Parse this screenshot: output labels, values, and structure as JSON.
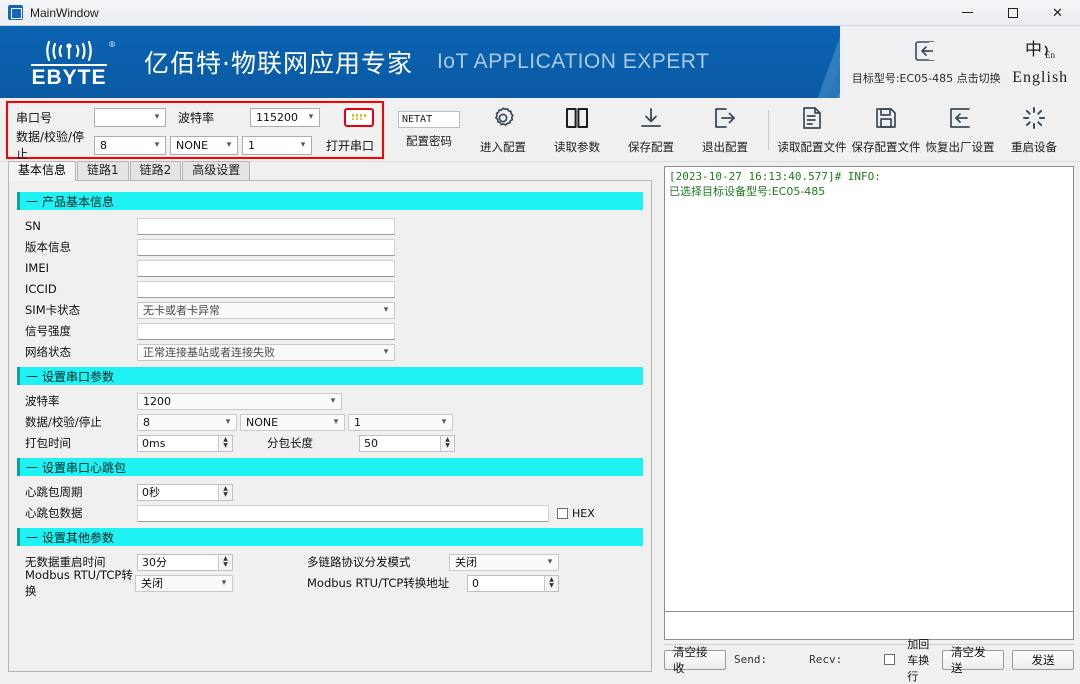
{
  "window": {
    "title": "MainWindow",
    "minimize": "—",
    "maximize": "□",
    "close": "✕"
  },
  "banner": {
    "logo_text": "EBYTE",
    "logo_reg": "®",
    "slogan_cn": "亿佰特·物联网应用专家",
    "slogan_en": "IoT APPLICATION EXPERT",
    "target_model": "目标型号:EC05-485 点击切换",
    "language": "English",
    "brand_blue": "#0a5fab",
    "stripe_colors": [
      "#2f7cbf",
      "#5393cb",
      "#7aadd8",
      "#a3c6e3",
      "#c6dbed",
      "#e2ecf4"
    ]
  },
  "serial": {
    "port_label": "串口号",
    "port_value": "",
    "baud_label": "波特率",
    "baud_value": "115200",
    "data_label": "数据/校验/停止",
    "data_bits": "8",
    "parity": "NONE",
    "stop_bits": "1",
    "open_label": "打开串口",
    "box_color": "#ff0000"
  },
  "toolbar": {
    "password_value": "NETAT",
    "password_label": "配置密码",
    "items": [
      {
        "label": "进入配置",
        "icon": "gear-icon"
      },
      {
        "label": "读取参数",
        "icon": "book-icon"
      },
      {
        "label": "保存配置",
        "icon": "download-icon"
      },
      {
        "label": "退出配置",
        "icon": "exit-icon"
      },
      {
        "label": "读取配置文件",
        "icon": "document-icon"
      },
      {
        "label": "保存配置文件",
        "icon": "save-icon"
      },
      {
        "label": "恢复出厂设置",
        "icon": "restore-icon"
      },
      {
        "label": "重启设备",
        "icon": "reboot-icon"
      }
    ]
  },
  "tabs": [
    {
      "label": "基本信息",
      "active": true
    },
    {
      "label": "链路1",
      "active": false
    },
    {
      "label": "链路2",
      "active": false
    },
    {
      "label": "高级设置",
      "active": false
    }
  ],
  "sections": {
    "product": {
      "title": "产品基本信息",
      "fields": [
        {
          "label": "SN",
          "value": "",
          "type": "text"
        },
        {
          "label": "版本信息",
          "value": "",
          "type": "text"
        },
        {
          "label": "IMEI",
          "value": "",
          "type": "text"
        },
        {
          "label": "ICCID",
          "value": "",
          "type": "text"
        },
        {
          "label": "SIM卡状态",
          "value": "无卡或者卡异常",
          "type": "select"
        },
        {
          "label": "信号强度",
          "value": "",
          "type": "text"
        },
        {
          "label": "网络状态",
          "value": "正常连接基站或者连接失败",
          "type": "select"
        }
      ]
    },
    "uart": {
      "title": "设置串口参数",
      "baud_label": "波特率",
      "baud_value": "1200",
      "data_label": "数据/校验/停止",
      "data_bits": "8",
      "parity": "NONE",
      "stop_bits": "1",
      "pack_time_label": "打包时间",
      "pack_time_value": "0ms",
      "pack_len_label": "分包长度",
      "pack_len_value": "50"
    },
    "heartbeat": {
      "title": "设置串口心跳包",
      "period_label": "心跳包周期",
      "period_value": "0秒",
      "data_label": "心跳包数据",
      "data_value": "",
      "hex_label": "HEX",
      "hex_checked": false
    },
    "other": {
      "title": "设置其他参数",
      "nodata_label": "无数据重启时间",
      "nodata_value": "30分",
      "multilink_label": "多链路协议分发模式",
      "multilink_value": "关闭",
      "modbus_label": "Modbus RTU/TCP转换",
      "modbus_value": "关闭",
      "modbus_addr_label": "Modbus RTU/TCP转换地址",
      "modbus_addr_value": "0"
    }
  },
  "log": {
    "line1": "[2023-10-27 16:13:40.577]# INFO:",
    "line2": "已选择目标设备型号:EC05-485",
    "text_color": "#1f7a1f",
    "send_value": ""
  },
  "bottom": {
    "clear_recv": "清空接收",
    "send_stat": "Send:",
    "recv_stat": "Recv:",
    "crlf_label": "加回车换行",
    "crlf_checked": false,
    "clear_send": "清空发送",
    "send_button": "发送"
  }
}
